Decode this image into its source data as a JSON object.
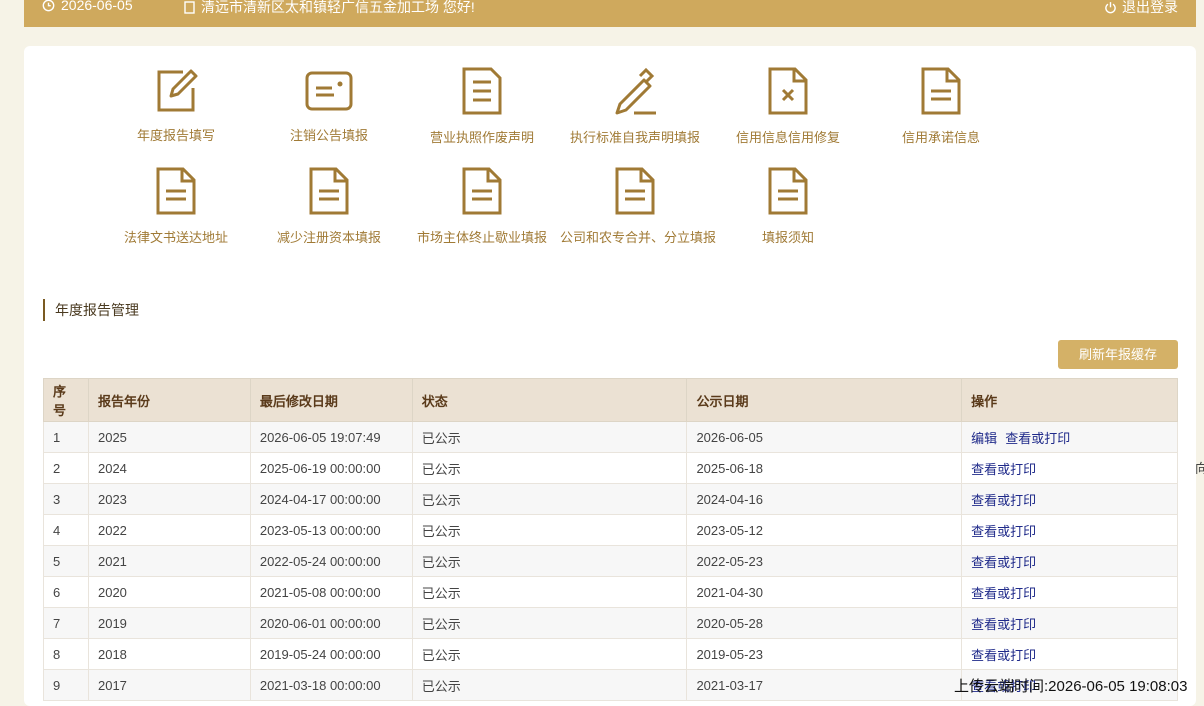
{
  "topbar": {
    "date": "2026-06-05",
    "greeting": "清远市清新区太和镇轻广信五金加工场 您好!",
    "logout": "退出登录"
  },
  "tiles": [
    {
      "label": "年度报告填写",
      "icon": "edit-icon"
    },
    {
      "label": "注销公告填报",
      "icon": "card-icon"
    },
    {
      "label": "营业执照作废声明",
      "icon": "document-icon"
    },
    {
      "label": "执行标准自我声明填报",
      "icon": "pencil-icon"
    },
    {
      "label": "信用信息信用修复",
      "icon": "document-x-icon"
    },
    {
      "label": "信用承诺信息",
      "icon": "document-icon"
    },
    {
      "label": "法律文书送达地址",
      "icon": "document-icon"
    },
    {
      "label": "减少注册资本填报",
      "icon": "document-icon"
    },
    {
      "label": "市场主体终止歇业填报",
      "icon": "document-icon"
    },
    {
      "label": "公司和农专合并、分立填报",
      "icon": "document-icon"
    },
    {
      "label": "填报须知",
      "icon": "document-icon"
    }
  ],
  "section": {
    "title": "年度报告管理",
    "refresh_button": "刷新年报缓存"
  },
  "table": {
    "headers": [
      "序号",
      "报告年份",
      "最后修改日期",
      "状态",
      "公示日期",
      "操作"
    ],
    "rows": [
      {
        "no": "1",
        "year": "2025",
        "modified": "2026-06-05 19:07:49",
        "status": "已公示",
        "pub": "2026-06-05",
        "actions": [
          "编辑",
          "查看或打印"
        ]
      },
      {
        "no": "2",
        "year": "2024",
        "modified": "2025-06-19 00:00:00",
        "status": "已公示",
        "pub": "2025-06-18",
        "actions": [
          "查看或打印"
        ]
      },
      {
        "no": "3",
        "year": "2023",
        "modified": "2024-04-17 00:00:00",
        "status": "已公示",
        "pub": "2024-04-16",
        "actions": [
          "查看或打印"
        ]
      },
      {
        "no": "4",
        "year": "2022",
        "modified": "2023-05-13 00:00:00",
        "status": "已公示",
        "pub": "2023-05-12",
        "actions": [
          "查看或打印"
        ]
      },
      {
        "no": "5",
        "year": "2021",
        "modified": "2022-05-24 00:00:00",
        "status": "已公示",
        "pub": "2022-05-23",
        "actions": [
          "查看或打印"
        ]
      },
      {
        "no": "6",
        "year": "2020",
        "modified": "2021-05-08 00:00:00",
        "status": "已公示",
        "pub": "2021-04-30",
        "actions": [
          "查看或打印"
        ]
      },
      {
        "no": "7",
        "year": "2019",
        "modified": "2020-06-01 00:00:00",
        "status": "已公示",
        "pub": "2020-05-28",
        "actions": [
          "查看或打印"
        ]
      },
      {
        "no": "8",
        "year": "2018",
        "modified": "2019-05-24 00:00:00",
        "status": "已公示",
        "pub": "2019-05-23",
        "actions": [
          "查看或打印"
        ]
      },
      {
        "no": "9",
        "year": "2017",
        "modified": "2021-03-18 00:00:00",
        "status": "已公示",
        "pub": "2021-03-17",
        "actions": [
          "查看或打印"
        ]
      }
    ]
  },
  "upload_time": "上传云端时间:2026-06-05 19:08:03",
  "side_fragment": "向",
  "colors": {
    "accent": "#cfa95d",
    "icon": "#a07a35",
    "link": "#1f2a8a"
  }
}
